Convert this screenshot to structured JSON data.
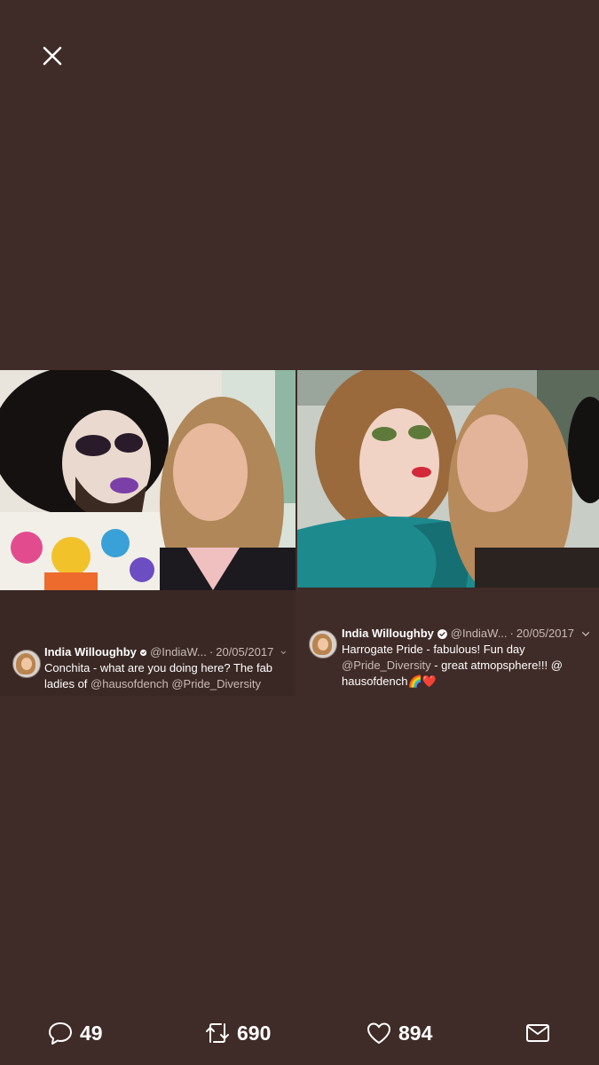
{
  "viewer": {
    "close_icon": "close-icon"
  },
  "tweets": [
    {
      "name": "India Willoughby",
      "handle": "@IndiaW...",
      "separator": "·",
      "date": "20/05/2017",
      "text_line1": "Conchita - what are you doing here? The fab",
      "text_line2_prefix": "ladies of ",
      "mention1": "@hausofdench",
      "mention2": "@Pride_Diversity"
    },
    {
      "name": "India Willoughby",
      "handle": "@IndiaW...",
      "separator": "·",
      "date": "20/05/2017",
      "text_line1": "Harrogate Pride - fabulous! Fun day",
      "mention1": "@Pride_Diversity",
      "text_line2_suffix": " - great atmopsphere!!! @",
      "text_line3": "hausofdench",
      "emoji": "🌈❤️"
    }
  ],
  "actions": {
    "reply_count": "49",
    "retweet_count": "690",
    "like_count": "894"
  },
  "colors": {
    "background": "#3f2b27",
    "text": "#ffffff",
    "muted": "#c9bbb6"
  }
}
